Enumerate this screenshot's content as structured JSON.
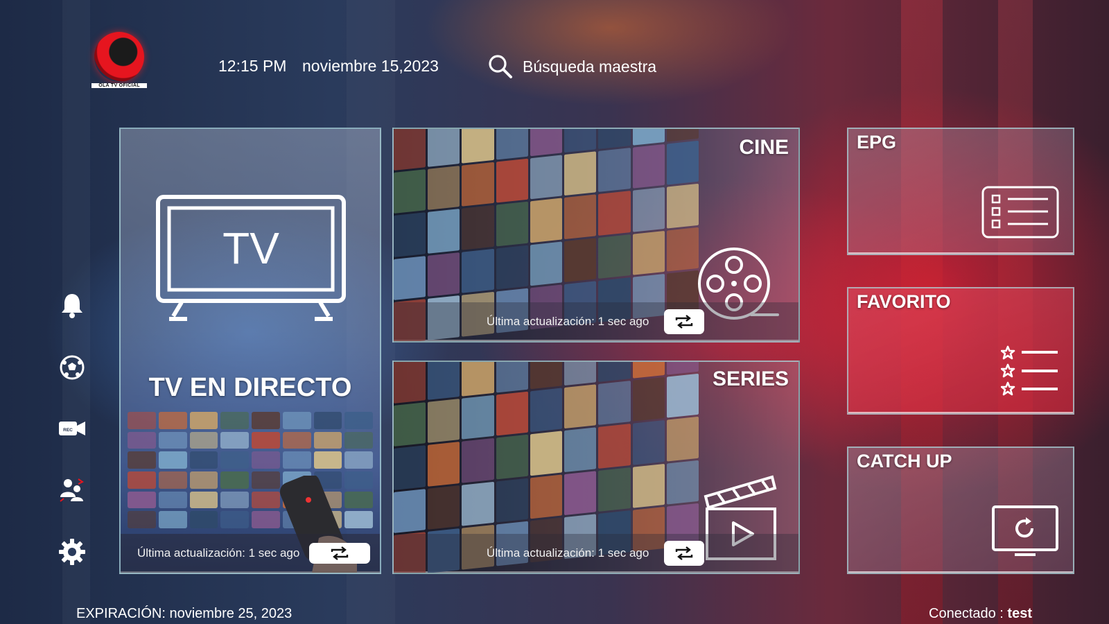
{
  "brand": {
    "logo_text": "OLA TV OFICIAL"
  },
  "header": {
    "time": "12:15 PM",
    "date": "noviembre 15,2023",
    "search_label": "Búsqueda maestra"
  },
  "side_menu": {
    "items": [
      {
        "name": "notifications",
        "icon": "bell-icon"
      },
      {
        "name": "sports",
        "icon": "soccer-ball-icon"
      },
      {
        "name": "recordings",
        "icon": "rec-camera-icon",
        "badge": "REC"
      },
      {
        "name": "switch-user",
        "icon": "switch-user-icon"
      },
      {
        "name": "settings",
        "icon": "gear-icon"
      }
    ]
  },
  "tiles": {
    "live": {
      "icon_text": "TV",
      "title": "TV EN DIRECTO",
      "update_text": "Última actualización: 1 sec ago"
    },
    "movies": {
      "title": "CINE",
      "update_text": "Última actualización: 1 sec ago"
    },
    "series": {
      "title": "SERIES",
      "update_text": "Última actualización: 1 sec ago"
    },
    "epg": {
      "title": "EPG"
    },
    "favorites": {
      "title": "FAVORITO"
    },
    "catchup": {
      "title": "CATCH UP"
    }
  },
  "footer": {
    "expiry": "EXPIRACIÓN: noviembre 25, 2023",
    "connected_label": "Conectado :",
    "connected_user": "test"
  },
  "colors": {
    "accent_red": "#e6151f",
    "tile_border": "#aad2d7",
    "refresh_button": "#ffffff"
  }
}
